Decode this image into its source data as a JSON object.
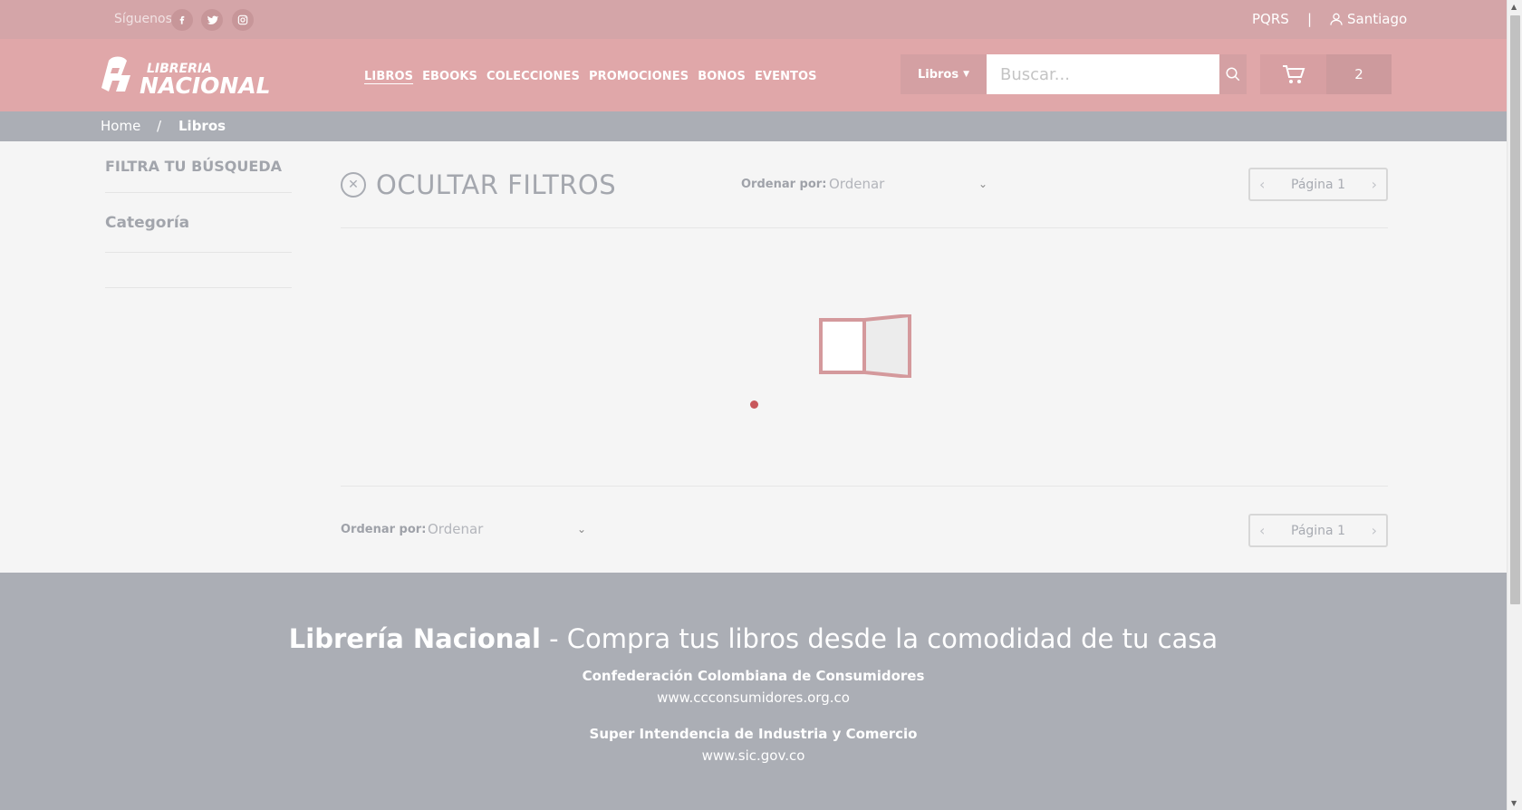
{
  "topbar": {
    "follow_label": "Síguenos",
    "social_icons": [
      "facebook-icon",
      "twitter-icon",
      "instagram-icon"
    ],
    "pqrs": "PQRS",
    "separator": "|",
    "user_name": "Santiago"
  },
  "header": {
    "brand_line1": "LIBRERIA",
    "brand_line2": "NACIONAL",
    "nav": [
      "LIBROS",
      "EBOOKS",
      "COLECCIONES",
      "PROMOCIONES",
      "BONOS",
      "EVENTOS"
    ],
    "category_dropdown": "Libros",
    "search_placeholder": "Buscar...",
    "cart_count": "2"
  },
  "breadcrumb": {
    "home": "Home",
    "separator": "/",
    "current": "Libros"
  },
  "sidebar": {
    "title": "FILTRA TU BÚSQUEDA",
    "category_label": "Categoría"
  },
  "main": {
    "hide_filters": "OCULTAR FILTROS",
    "sort_label": "Ordenar por:",
    "sort_value": "Ordenar",
    "page_label": "Página 1"
  },
  "footer": {
    "brand": "Librería Nacional",
    "tagline": " - Compra tus libros desde la comodidad de tu casa",
    "org1_name": "Confederación Colombiana de Consumidores",
    "org1_url": "www.ccconsumidores.org.co",
    "org2_name": "Super Intendencia de Industria y Comercio",
    "org2_url": "www.sic.gov.co"
  },
  "colors": {
    "topbar": "#d4a5a8",
    "header": "#e0a7a9",
    "breadcrumb_bar": "#abaeb5",
    "accent": "#c8585c"
  }
}
